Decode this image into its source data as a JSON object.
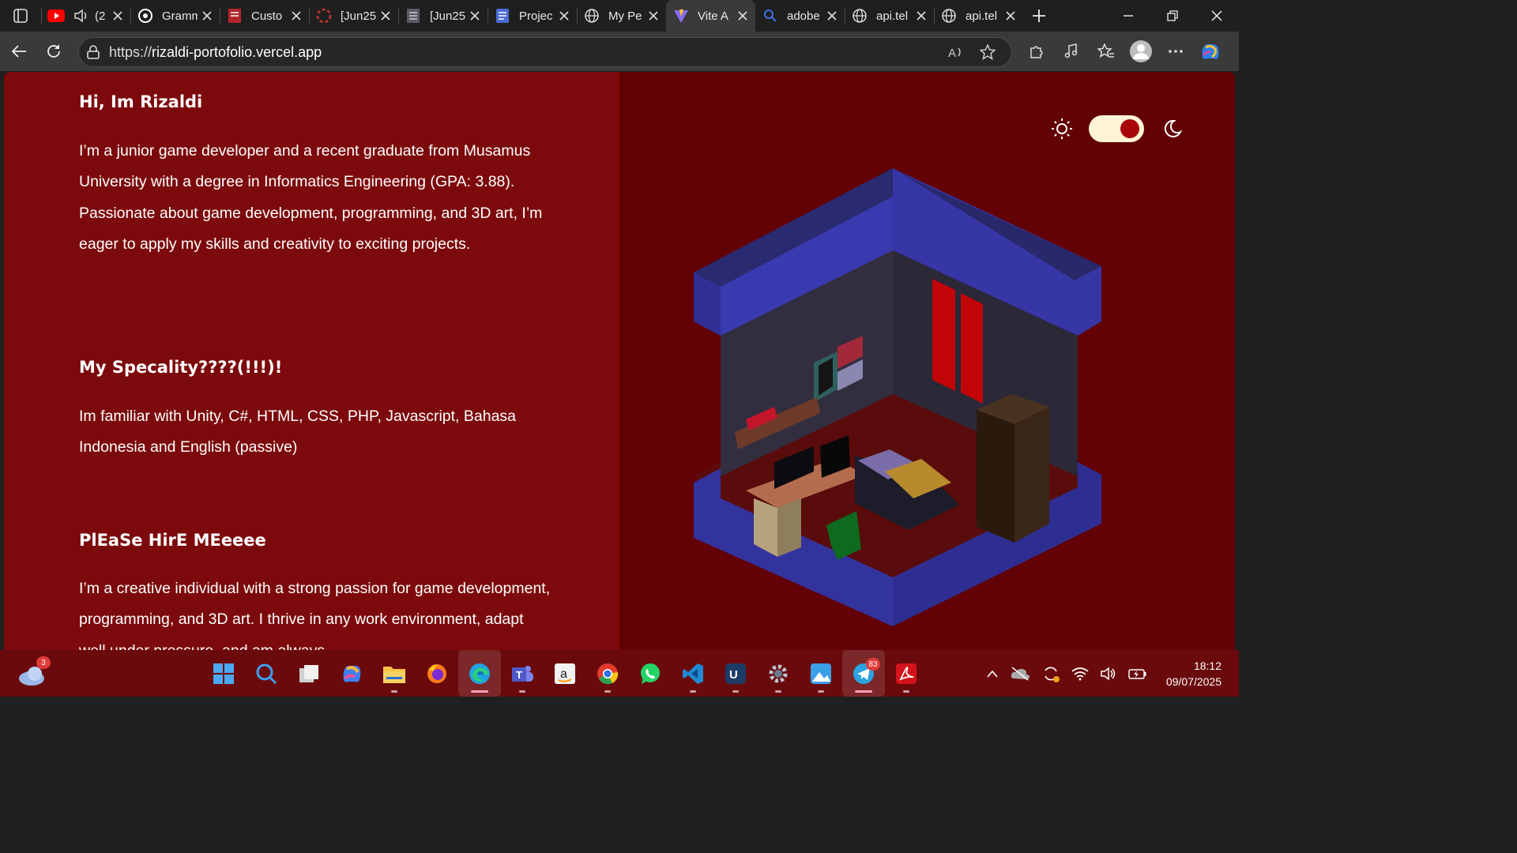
{
  "browser": {
    "tabs": [
      {
        "label": "(2",
        "icon": "youtube-icon"
      },
      {
        "label": "Gramm",
        "icon": "grammarly-icon"
      },
      {
        "label": "Custo",
        "icon": "document-icon"
      },
      {
        "label": "[Jun25",
        "icon": "loading-icon"
      },
      {
        "label": "[Jun25",
        "icon": "table-icon"
      },
      {
        "label": "Projec",
        "icon": "docs-icon"
      },
      {
        "label": "My Pe",
        "icon": "globe-icon"
      },
      {
        "label": "Vite A",
        "icon": "vite-icon",
        "active": true
      },
      {
        "label": "adobe",
        "icon": "search-icon"
      },
      {
        "label": "api.tel",
        "icon": "globe-icon"
      },
      {
        "label": "api.tel",
        "icon": "globe-icon"
      }
    ],
    "url_prefix": "https://",
    "url_host": "rizaldi-portofolio.vercel.app"
  },
  "page": {
    "section1": {
      "title": "Hi, Im Rizaldi",
      "body": "I’m a junior game developer and a recent graduate from Musamus University with a degree in Informatics Engineering (GPA: 3.88). Passionate about game development, programming, and 3D art, I’m eager to apply my skills and creativity to exciting projects."
    },
    "section2": {
      "title": "My Specality????(!!!)!",
      "body": "Im familiar with Unity, C#, HTML, CSS, PHP, Javascript, Bahasa Indonesia and English (passive)"
    },
    "section3": {
      "title": "PlEaSe HirE MEeeee",
      "body": "I’m a creative individual with a strong passion for game development, programming, and 3D art. I thrive in any work environment, adapt well under pressure, and am always"
    },
    "theme_toggle": {
      "mode": "dark"
    }
  },
  "taskbar": {
    "weather_badge": "3",
    "telegram_badge": "83",
    "time": "18:12",
    "date": "09/07/2025"
  },
  "colors": {
    "left_bg": "#7c0a0c",
    "right_bg": "#620204",
    "room_blue": "#3a3aa8",
    "toggle_knob": "#a8050a"
  }
}
